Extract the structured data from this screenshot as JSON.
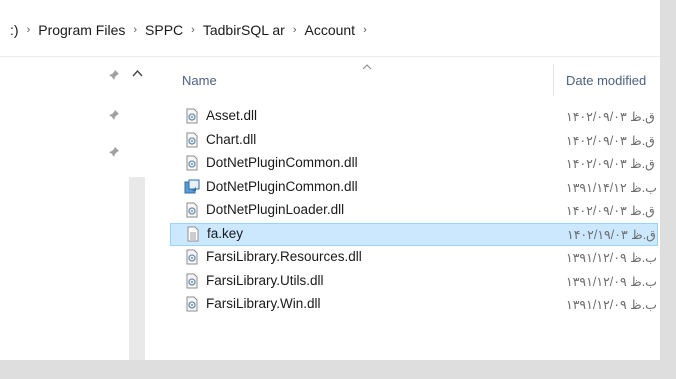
{
  "breadcrumb": {
    "items": [
      ":)",
      "Program Files",
      "SPPC",
      "TadbirSQL ar",
      "Account"
    ],
    "separator": "›"
  },
  "columns": {
    "name": "Name",
    "date_modified": "Date modified"
  },
  "files": [
    {
      "name": "Asset.dll",
      "icon": "dll-icon",
      "date": "ق.ظ ۱۴۰۲/۰۹/۰۳",
      "selected": false
    },
    {
      "name": "Chart.dll",
      "icon": "dll-icon",
      "date": "ق.ظ ۱۴۰۲/۰۹/۰۳",
      "selected": false
    },
    {
      "name": "DotNetPluginCommon.dll",
      "icon": "dll-icon",
      "date": "ق.ظ ۱۴۰۲/۰۹/۰۳",
      "selected": false
    },
    {
      "name": "DotNetPluginCommon.dll",
      "icon": "setup-icon",
      "date": "ب.ظ ۱۳۹۱/۱۴/۱۲",
      "selected": false
    },
    {
      "name": "DotNetPluginLoader.dll",
      "icon": "dll-icon",
      "date": "ق.ظ ۱۴۰۲/۰۹/۰۳",
      "selected": false
    },
    {
      "name": "fa.key",
      "icon": "text-file-icon",
      "date": "ق.ظ ۱۴۰۲/۱۹/۰۳",
      "selected": true
    },
    {
      "name": "FarsiLibrary.Resources.dll",
      "icon": "dll-icon",
      "date": "ب.ظ ۱۳۹۱/۱۲/۰۹",
      "selected": false
    },
    {
      "name": "FarsiLibrary.Utils.dll",
      "icon": "dll-icon",
      "date": "ب.ظ ۱۳۹۱/۱۲/۰۹",
      "selected": false
    },
    {
      "name": "FarsiLibrary.Win.dll",
      "icon": "dll-icon",
      "date": "ب.ظ ۱۳۹۱/۱۲/۰۹",
      "selected": false
    }
  ],
  "colors": {
    "header_text": "#4d6082",
    "selection_bg": "#cce8ff",
    "selection_border": "#99d1ff"
  }
}
